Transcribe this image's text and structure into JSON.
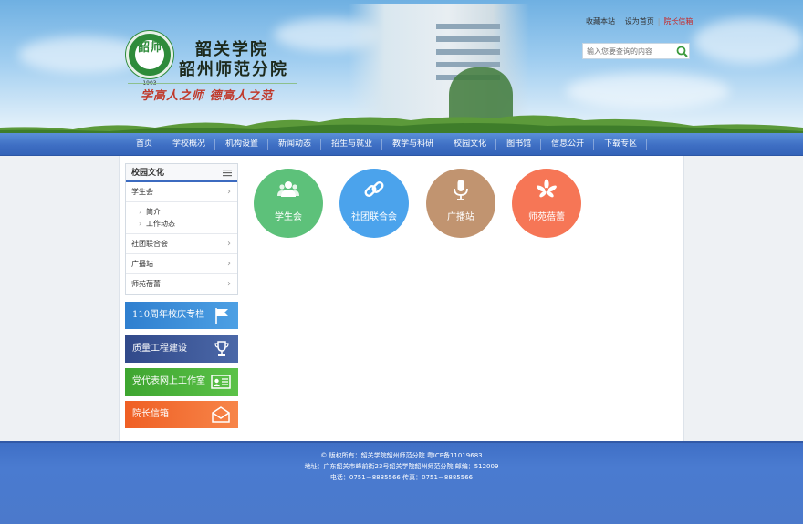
{
  "header": {
    "top_links": [
      "收藏本站",
      "设为首页",
      "院长信箱"
    ],
    "search_placeholder": "输入您要查询的内容",
    "logo": {
      "seal_text": "韶师",
      "seal_year": "1903",
      "name_line1": "韶关学院",
      "name_line2": "韶州师范分院",
      "motto": "学高人之师 德高人之范"
    }
  },
  "nav": {
    "items": [
      "首页",
      "学校概况",
      "机构设置",
      "新闻动态",
      "招生与就业",
      "教学与科研",
      "校园文化",
      "图书馆",
      "信息公开",
      "下载专区"
    ]
  },
  "sidebar": {
    "title": "校园文化",
    "items": [
      {
        "label": "学生会",
        "children": [
          "简介",
          "工作动态"
        ]
      },
      {
        "label": "社团联合会"
      },
      {
        "label": "广播站"
      },
      {
        "label": "师苑蓓蕾"
      }
    ],
    "banners": [
      {
        "label": "110周年校庆专栏",
        "color": "#3e8fd6"
      },
      {
        "label": "质量工程建设",
        "color": "#3d5a97"
      },
      {
        "label": "党代表网上工作室",
        "color": "#49b53a"
      },
      {
        "label": "院长信箱",
        "color": "#f26b2e"
      }
    ]
  },
  "main": {
    "circles": [
      {
        "label": "学生会",
        "color": "#5dc17a",
        "icon": "users-icon"
      },
      {
        "label": "社团联合会",
        "color": "#4ba3ec",
        "icon": "link-icon"
      },
      {
        "label": "广播站",
        "color": "#c19470",
        "icon": "microphone-icon"
      },
      {
        "label": "师苑蓓蕾",
        "color": "#f67656",
        "icon": "flower-icon"
      }
    ]
  },
  "footer": {
    "line1": "© 版权所有：韶关学院韶州师范分院 粤ICP备11019683",
    "line2": "地址：广东韶关市峰前街23号韶关学院韶州师范分院 邮编：512009",
    "line3": "电话：0751－8885566 传真：0751－8885566"
  }
}
